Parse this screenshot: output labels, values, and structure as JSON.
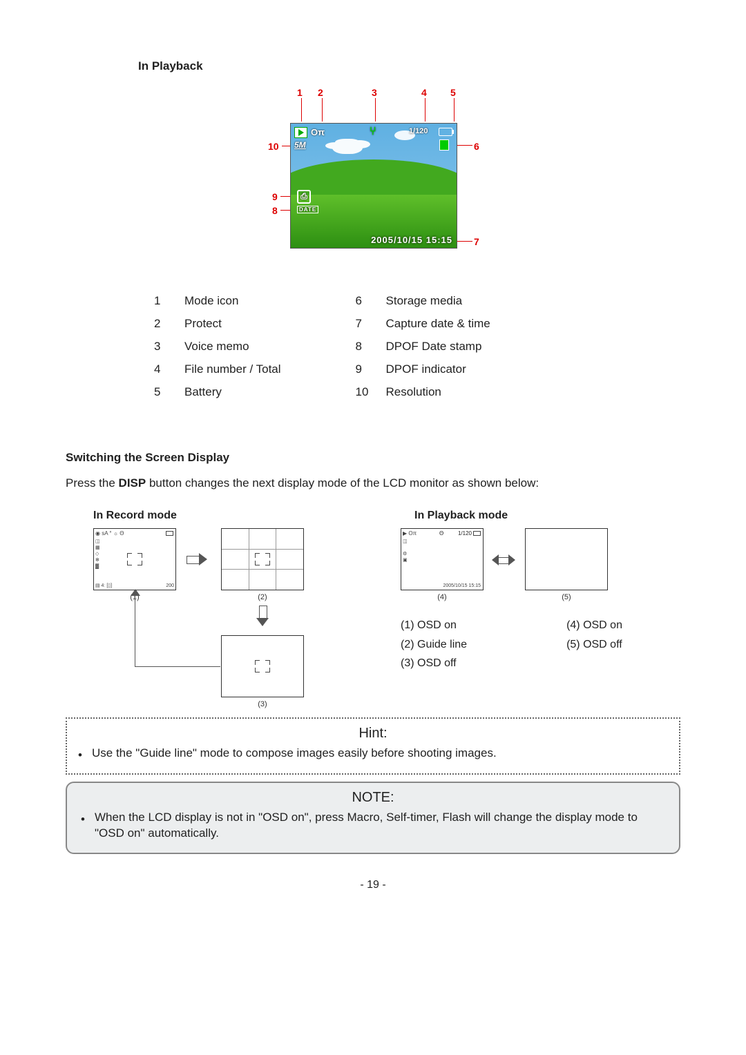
{
  "sections": {
    "in_playback_title": "In Playback",
    "switch_heading": "Switching the Screen Display",
    "para_before": "Press the ",
    "para_bold": "DISP",
    "para_after": " button changes the next display mode of the LCD monitor as shown below:",
    "in_record_title": "In Record mode",
    "in_playback_mode_title": "In Playback mode"
  },
  "lcd": {
    "file_number": "1/120",
    "resolution": "5M",
    "date_label": "DATE",
    "datetime": "2005/10/15 15:15",
    "protect_glyph": "Oπ",
    "voice_glyph": "⑂"
  },
  "callouts": {
    "n1": "1",
    "n2": "2",
    "n3": "3",
    "n4": "4",
    "n5": "5",
    "n6": "6",
    "n7": "7",
    "n8": "8",
    "n9": "9",
    "n10": "10"
  },
  "legend": [
    {
      "n": "1",
      "label": "Mode icon"
    },
    {
      "n": "2",
      "label": "Protect"
    },
    {
      "n": "3",
      "label": "Voice memo"
    },
    {
      "n": "4",
      "label": "File number / Total"
    },
    {
      "n": "5",
      "label": "Battery"
    },
    {
      "n": "6",
      "label": "Storage media"
    },
    {
      "n": "7",
      "label": "Capture date & time"
    },
    {
      "n": "8",
      "label": "DPOF Date stamp"
    },
    {
      "n": "9",
      "label": "DPOF indicator"
    },
    {
      "n": "10",
      "label": "Resolution"
    }
  ],
  "mini": {
    "rec_tl": "◉ sA ° ☼ Θ",
    "rec_left": "◫\n▦\n◇\n✻\n▓",
    "rec_bl": "▤ 4ː [▯]",
    "rec_br": "200",
    "cap1": "(1)",
    "cap2": "(2)",
    "cap3": "(3)",
    "cap4": "(4)",
    "cap5": "(5)",
    "pb_tl": "▶ Oπ",
    "pb_top_mid": "Θ",
    "pb_top_right": "1/120",
    "pb_left": "◫\n\n⚙\n▣",
    "pb_date": "2005/10/15 15:15"
  },
  "osd_labels": {
    "l1": "(1) OSD on",
    "l2": "(2) Guide line",
    "l3": "(3) OSD off",
    "l4": "(4) OSD on",
    "l5": "(5) OSD off"
  },
  "hint": {
    "title": "Hint:",
    "text": "Use the \"Guide line\" mode to compose images easily before shooting images."
  },
  "note": {
    "title": "NOTE:",
    "text": "When the LCD display is not in \"OSD on\", press Macro, Self-timer, Flash will change the display mode to \"OSD on\" automatically."
  },
  "page_number": "- 19 -"
}
